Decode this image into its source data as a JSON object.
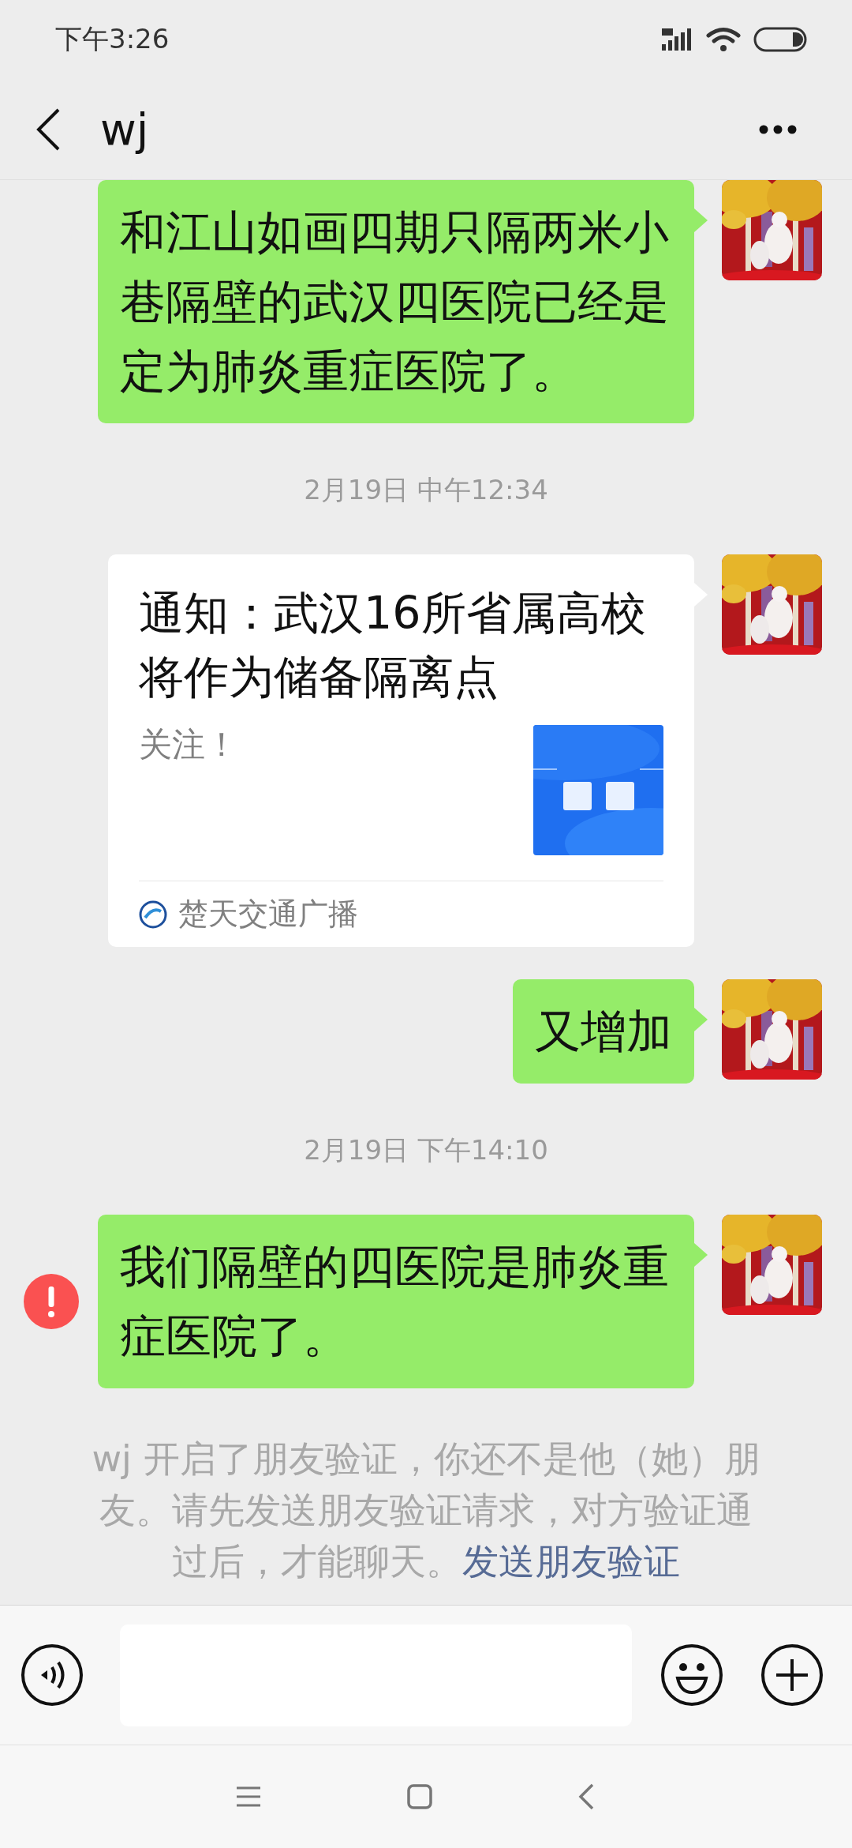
{
  "status_bar": {
    "time": "下午3:26"
  },
  "header": {
    "title": "wj"
  },
  "messages": [
    {
      "kind": "text",
      "text": "和江山如画四期只隔两米小巷隔壁的武汉四医院已经是定为肺炎重症医院了。",
      "failed": false
    },
    {
      "kind": "time",
      "text": "2月19日 中午12:34"
    },
    {
      "kind": "card",
      "title": "通知：武汉16所省属高校将作为储备隔离点",
      "description": "关注！",
      "source": "楚天交通广播"
    },
    {
      "kind": "text",
      "text": "又增加",
      "failed": false
    },
    {
      "kind": "time",
      "text": "2月19日 下午14:10"
    },
    {
      "kind": "text",
      "text": "我们隔壁的四医院是肺炎重症医院了。",
      "failed": true
    }
  ],
  "notice": {
    "text": "wj 开启了朋友验证，你还不是他（她）朋友。请先发送朋友验证请求，对方验证通过后，才能聊天。",
    "link": "发送朋友验证"
  }
}
